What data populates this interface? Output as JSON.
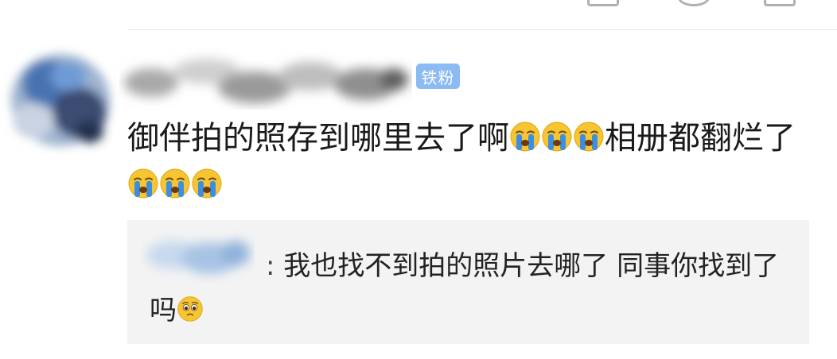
{
  "badge": {
    "label": "铁粉"
  },
  "comment": {
    "segments": [
      {
        "type": "text",
        "value": "御伴拍的照存到哪里去了啊"
      },
      {
        "type": "emoji",
        "name": "crying-face-emoji"
      },
      {
        "type": "emoji",
        "name": "crying-face-emoji"
      },
      {
        "type": "emoji",
        "name": "crying-face-emoji"
      },
      {
        "type": "text",
        "value": "相册都翻烂了"
      },
      {
        "type": "emoji",
        "name": "crying-face-emoji"
      },
      {
        "type": "emoji",
        "name": "crying-face-emoji"
      },
      {
        "type": "emoji",
        "name": "crying-face-emoji"
      }
    ]
  },
  "reply": {
    "separator": ":",
    "segments": [
      {
        "type": "text",
        "value": "我也找不到拍的照片去哪了 同事你找到了吗"
      },
      {
        "type": "emoji",
        "name": "pleading-face-emoji"
      }
    ]
  },
  "colors": {
    "badge_bg": "#8bbbf2",
    "reply_bg": "#f3f3f3",
    "emoji_yellow": "#f7c531",
    "tear_blue": "#3c8fe0"
  },
  "icons": [
    "crying-face-emoji",
    "pleading-face-emoji"
  ]
}
